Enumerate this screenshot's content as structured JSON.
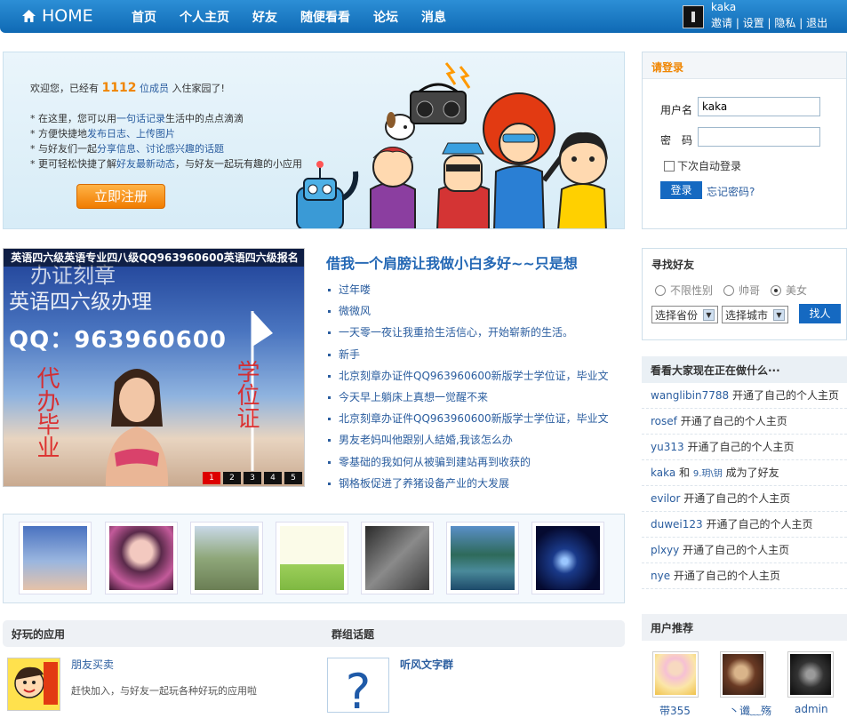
{
  "nav": {
    "home": "HOME",
    "items": [
      "首页",
      "个人主页",
      "好友",
      "随便看看",
      "论坛",
      "消息"
    ]
  },
  "user": {
    "name": "kaka",
    "links": [
      "邀请",
      "设置",
      "隐私",
      "退出"
    ]
  },
  "banner": {
    "welcome_pre": "欢迎您，已经有",
    "member_count": "1112",
    "unit": "位成员",
    "welcome_post": "入住家园了!",
    "bullets": [
      {
        "pre": "在这里，您可以用",
        "link": "一句话记录",
        "post": "生活中的点点滴滴"
      },
      {
        "pre": "方便快捷地",
        "link": "发布日志、上传图片",
        "post": ""
      },
      {
        "pre": "与好友们一起",
        "link": "分享信息、讨论感兴趣的话题",
        "post": ""
      },
      {
        "pre": "更可轻松快捷了解",
        "link": "好友最新动态",
        "post": "，与好友一起玩有趣的小应用"
      }
    ],
    "register_button": "立即注册"
  },
  "login": {
    "title": "请登录",
    "username_label": "用户名",
    "username_value": "kaka",
    "password_label": "密　码",
    "password_value": "",
    "remember_label": "下次自动登录",
    "login_button": "登录",
    "forgot_link": "忘记密码?"
  },
  "slideshow": {
    "caption": "英语四六级英语专业四八级QQ963960600英语四六级报名",
    "image_text": [
      "办证刻章",
      "英语四六级办理",
      "QQ：963960600",
      "代办毕业",
      "学位证"
    ],
    "pages": [
      "1",
      "2",
      "3",
      "4",
      "5"
    ],
    "active_page": "1"
  },
  "feature": {
    "title": "借我一个肩膀让我做小白多好~~只是想",
    "items": [
      "过年喽",
      "微微风",
      "一天零一夜让我重拾生活信心，开始崭新的生活。",
      "新手",
      "北京刻章办证件QQ963960600新版学士学位证，毕业文",
      "今天早上躺床上真想一觉醒不来",
      "北京刻章办证件QQ963960600新版学士学位证，毕业文",
      "男友老妈叫他跟别人結婚,我该怎么办",
      "零基础的我如何从被骗到建站再到收获的",
      "钢格板促进了养猪设备产业的大发展"
    ]
  },
  "find_friend": {
    "title": "寻找好友",
    "gender_options": [
      "不限性别",
      "帅哥",
      "美女"
    ],
    "gender_selected": "美女",
    "province_select": "选择省份",
    "city_select": "选择城市",
    "search_button": "找人"
  },
  "activity": {
    "title": "看看大家现在正在做什么···",
    "items": [
      {
        "user": "wanglibin7788",
        "text": "开通了自己的个人主页"
      },
      {
        "user": "rosef",
        "text": "开通了自己的个人主页"
      },
      {
        "user": "yu313",
        "text": "开通了自己的个人主页"
      },
      {
        "user": "kaka",
        "text": "和",
        "user2": "9.玥\\钥",
        "text2": "成为了好友"
      },
      {
        "user": "evilor",
        "text": "开通了自己的个人主页"
      },
      {
        "user": "duwei123",
        "text": "开通了自己的个人主页"
      },
      {
        "user": "plxyy",
        "text": "开通了自己的个人主页"
      },
      {
        "user": "nye",
        "text": "开通了自己的个人主页"
      }
    ]
  },
  "apps": {
    "title": "好玩的应用",
    "app_name": "朋友买卖",
    "app_icon_text": "朋友买卖",
    "app_desc": "赶快加入，与好友一起玩各种好玩的应用啦"
  },
  "groups": {
    "title": "群组话题",
    "group_name": "听风文字群"
  },
  "recommend": {
    "title": "用户推荐",
    "users": [
      "带355",
      "丶谶﹏殇",
      "admin"
    ]
  }
}
